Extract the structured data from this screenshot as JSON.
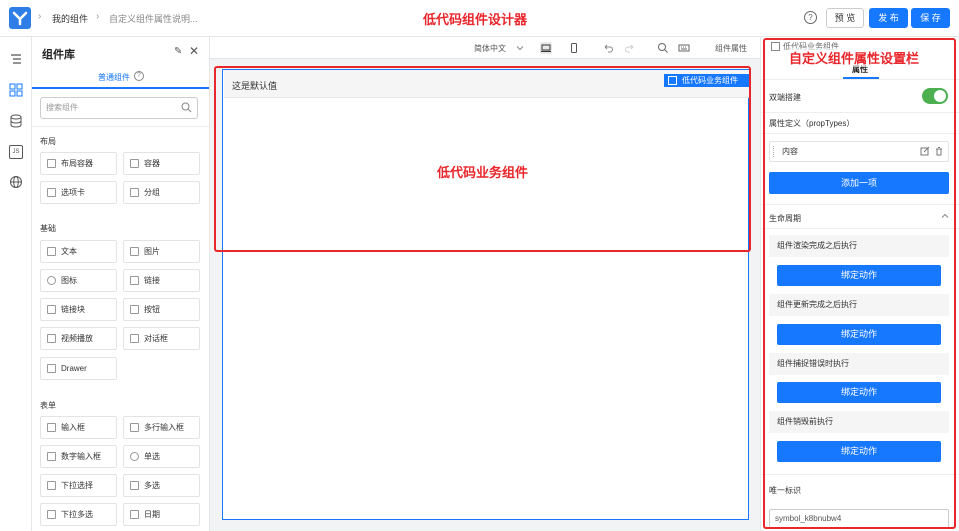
{
  "header": {
    "breadcrumb": [
      "我的组件",
      "自定义组件属性说明..."
    ],
    "annotation_title": "低代码组件设计器",
    "help_glyph": "?",
    "preview_label": "预 览",
    "publish_label": "发 布",
    "save_label": "保 存"
  },
  "left_strip": {
    "icons": [
      "outline-icon",
      "components-icon",
      "datasource-icon",
      "js-icon",
      "globe-icon"
    ],
    "js_label": "JS"
  },
  "library": {
    "title": "组件库",
    "pin_glyph": "✎",
    "close_glyph": "✕",
    "tab": "普通组件",
    "tab_help": "?",
    "search_placeholder": "搜索组件",
    "sections": [
      {
        "title": "布局",
        "items": [
          "布局容器",
          "容器",
          "选项卡",
          "分组"
        ]
      },
      {
        "title": "基础",
        "items": [
          "文本",
          "图片",
          "图标",
          "链接",
          "链接块",
          "按钮",
          "视频播放",
          "对话框",
          "Drawer"
        ]
      },
      {
        "title": "表单",
        "items": [
          "输入框",
          "多行输入框",
          "数字输入框",
          "单选",
          "下拉选择",
          "多选",
          "下拉多选",
          "日期"
        ]
      }
    ]
  },
  "toolbar": {
    "language": "简体中文",
    "props_label": "组件属性"
  },
  "canvas": {
    "default_text": "这是默认值",
    "selected_label": "低代码业务组件",
    "annotation": "低代码业务组件"
  },
  "right_panel": {
    "component_name": "低代码业务组件",
    "annotation_title": "自定义组件属性设置栏",
    "tab": "属性",
    "two_way_label": "双端搭建",
    "two_way_enabled": true,
    "prop_types_label": "属性定义（propTypes）",
    "prop_item": "内容",
    "add_item_label": "添加一项",
    "lifecycle_label": "生命周期",
    "lifecycle": [
      {
        "title": "组件渲染完成之后执行",
        "action": "绑定动作"
      },
      {
        "title": "组件更新完成之后执行",
        "action": "绑定动作"
      },
      {
        "title": "组件捕捉错误时执行",
        "action": "绑定动作"
      },
      {
        "title": "组件销毁前执行",
        "action": "绑定动作"
      }
    ],
    "uid_label": "唯一标识",
    "uid_value": "symbol_k8bnubw4"
  },
  "colors": {
    "accent": "#1677ff",
    "annotation_red": "#e8262b",
    "toggle_on": "#4caf50"
  }
}
